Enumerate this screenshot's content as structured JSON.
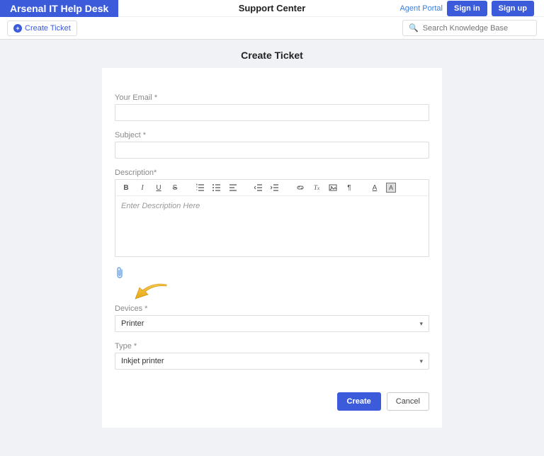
{
  "header": {
    "brand": "Arsenal IT Help Desk",
    "center_title": "Support Center",
    "agent_portal": "Agent Portal",
    "signin": "Sign in",
    "signup": "Sign up"
  },
  "subbar": {
    "create_ticket": "Create Ticket",
    "search_placeholder": "Search Knowledge Base"
  },
  "page": {
    "title": "Create Ticket"
  },
  "form": {
    "email_label": "Your Email *",
    "email_value": "",
    "subject_label": "Subject *",
    "subject_value": "",
    "description_label": "Description*",
    "description_placeholder": "Enter Description Here",
    "devices_label": "Devices *",
    "devices_value": "Printer",
    "type_label": "Type *",
    "type_value": "Inkjet printer",
    "create_btn": "Create",
    "cancel_btn": "Cancel"
  },
  "toolbar_icons": [
    "B",
    "I",
    "U",
    "S",
    "ol",
    "ul",
    "indent-left",
    "outdent",
    "indent-right",
    "link",
    "tx",
    "image",
    "paragraph",
    "A",
    "A-bg"
  ]
}
